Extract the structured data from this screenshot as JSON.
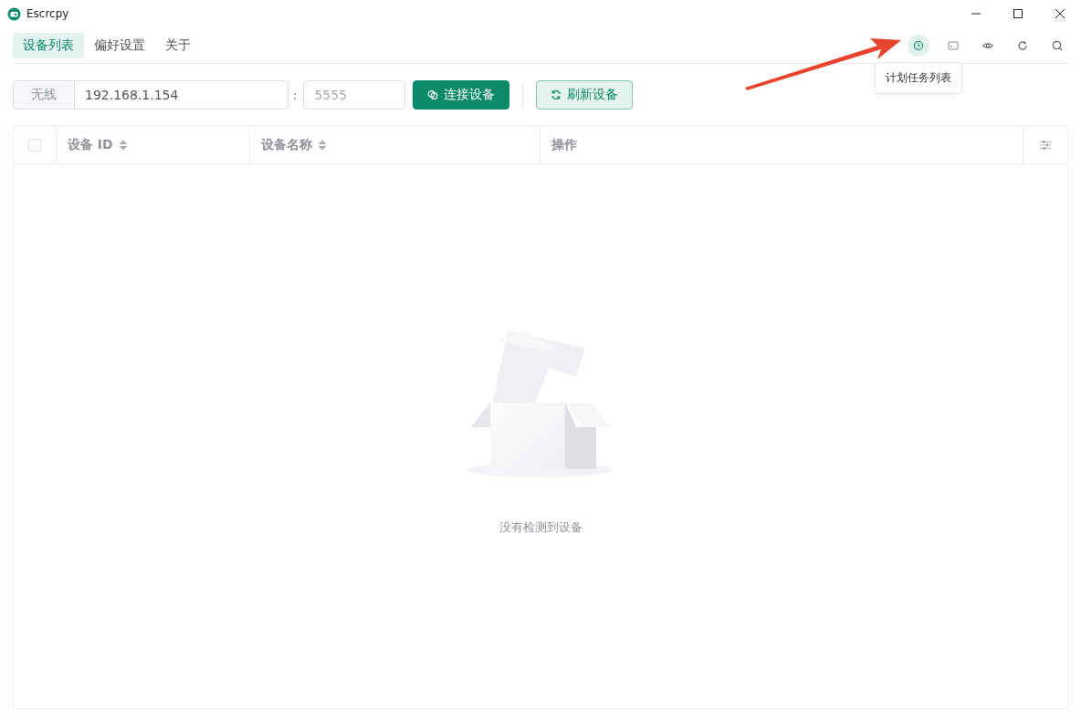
{
  "window": {
    "title": "Escrcpy"
  },
  "tabs": [
    {
      "label": "设备列表",
      "selected": true
    },
    {
      "label": "偏好设置",
      "selected": false
    },
    {
      "label": "关于",
      "selected": false
    }
  ],
  "toolbar_icons": [
    {
      "kind": "clock",
      "selected": true
    },
    {
      "kind": "terminal",
      "selected": false
    },
    {
      "kind": "eye",
      "selected": false
    },
    {
      "kind": "refresh",
      "selected": false
    },
    {
      "kind": "search",
      "selected": false
    }
  ],
  "tooltip": "计划任务列表",
  "connection": {
    "mode_label": "无线",
    "host": "192.168.1.154",
    "separator": ":",
    "port_placeholder": "5555"
  },
  "buttons": [
    {
      "kind": "connect",
      "label": "连接设备"
    },
    {
      "kind": "refresh",
      "label": "刷新设备"
    }
  ],
  "table": {
    "select_all_checked": false,
    "columns": [
      {
        "label": "设备 ID",
        "kind": "sortable"
      },
      {
        "label": "设备名称",
        "kind": "sortable"
      },
      {
        "label": "操作",
        "kind": "plain"
      }
    ],
    "empty_text": "没有检测到设备"
  }
}
